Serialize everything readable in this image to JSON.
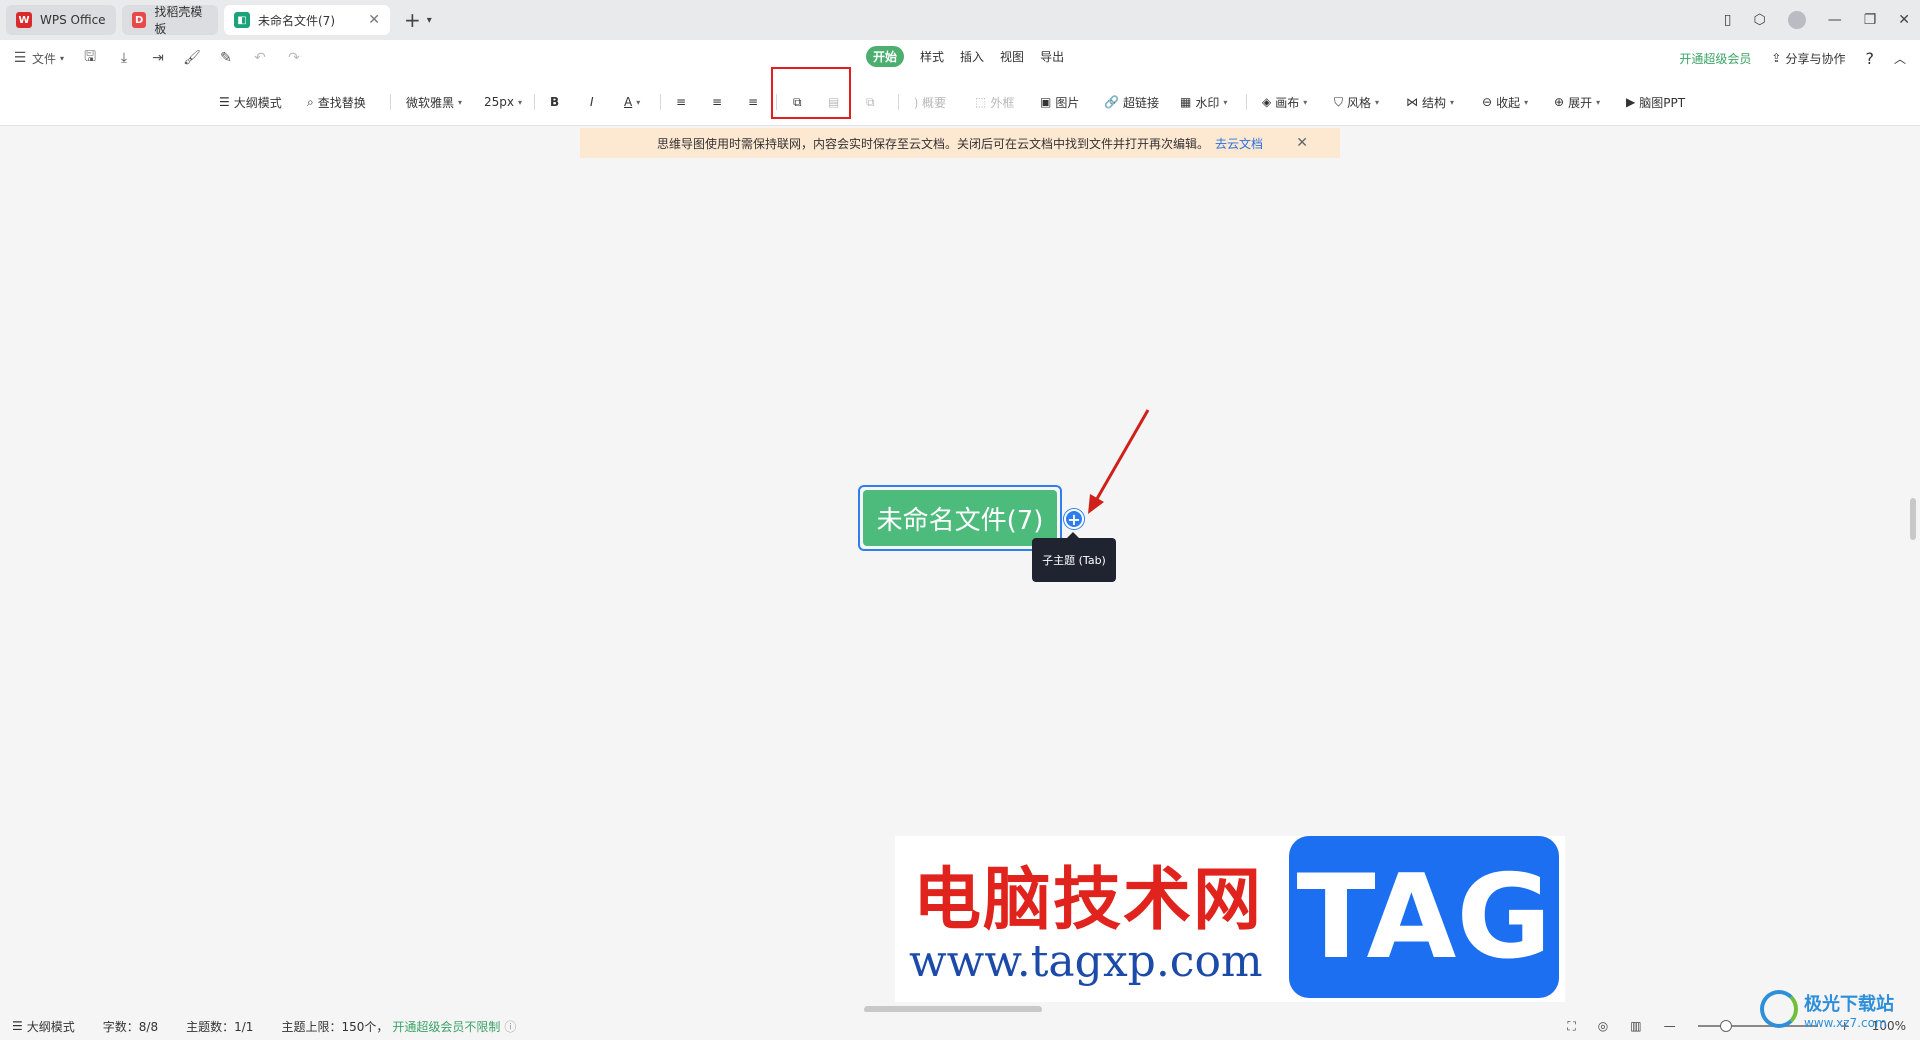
{
  "tabs": [
    {
      "label": "WPS Office",
      "icon": "wps-logo-icon"
    },
    {
      "label": "找稻壳模板",
      "icon": "docer-logo-icon"
    },
    {
      "label": "未命名文件(7)",
      "icon": "mindmap-file-icon"
    }
  ],
  "menu": {
    "file_label": "文件",
    "tabs": [
      "开始",
      "样式",
      "插入",
      "视图",
      "导出"
    ],
    "active_tab": "开始",
    "vip_label": "开通超级会员",
    "share_label": "分享与协作",
    "help_label": "?"
  },
  "toolbar": {
    "outline_mode": "大纲模式",
    "find_replace": "查找替换",
    "font_family": "微软雅黑",
    "font_size": "25px",
    "bold": "B",
    "italic": "I",
    "font_color": "A",
    "summary": "概要",
    "border": "外框",
    "image": "图片",
    "hyperlink": "超链接",
    "watermark": "水印",
    "canvas": "画布",
    "style": "风格",
    "structure": "结构",
    "collapse": "收起",
    "expand": "展开",
    "mindmap_ppt": "脑图PPT"
  },
  "notice": {
    "text": "思维导图使用时需保持联网，内容会实时保存至云文档。关闭后可在云文档中找到文件并打开再次编辑。",
    "link": "去云文档"
  },
  "canvas": {
    "root_topic": "未命名文件(7)",
    "tooltip": "子主题 (Tab)"
  },
  "watermark": {
    "cn_text": "电脑技术网",
    "url_text": "www.tagxp.com",
    "tag_text": "TAG"
  },
  "statusbar": {
    "outline_mode": "大纲模式",
    "word_count": "字数：8/8",
    "topic_count": "主题数：1/1",
    "topic_limit": "主题上限：150个，",
    "vip_unlimited": "开通超级会员不限制",
    "zoom": "100%"
  },
  "brand": {
    "name": "极光下载站",
    "url": "www.xz7.com"
  },
  "colors": {
    "accent_green": "#4cbb7c",
    "selection_blue": "#2f7ef0",
    "highlight_red": "#e02020",
    "notice_bg": "#fde8d2"
  }
}
